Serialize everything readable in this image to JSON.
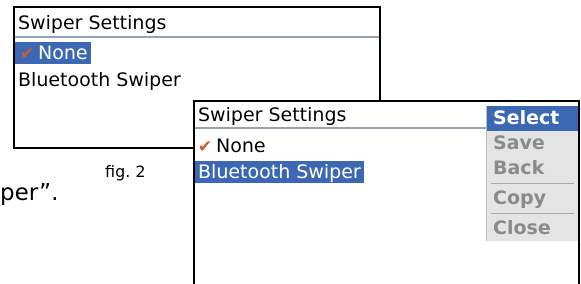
{
  "screen1": {
    "title": "Swiper Settings",
    "items": [
      {
        "label": "None",
        "checked": true,
        "highlighted": true
      },
      {
        "label": "Bluetooth Swiper",
        "checked": false,
        "highlighted": false
      }
    ]
  },
  "screen2": {
    "title": "Swiper Settings",
    "items": [
      {
        "label": "None",
        "checked": true,
        "highlighted": false
      },
      {
        "label": "Bluetooth Swiper",
        "checked": false,
        "highlighted": true
      }
    ],
    "menu": {
      "items": [
        "Select",
        "Save",
        "Back",
        "Copy",
        "Close"
      ],
      "selected": "Select"
    }
  },
  "caption": "fig. 2",
  "background_text": "per”.",
  "colors": {
    "highlight": "#3c67b2",
    "checkmark": "#d45a24",
    "menu_bg": "#e4e4e4",
    "menu_disabled_text": "#8a8a8a",
    "divider": "#93a3b3"
  },
  "icons": {
    "check": "checkmark-icon"
  }
}
